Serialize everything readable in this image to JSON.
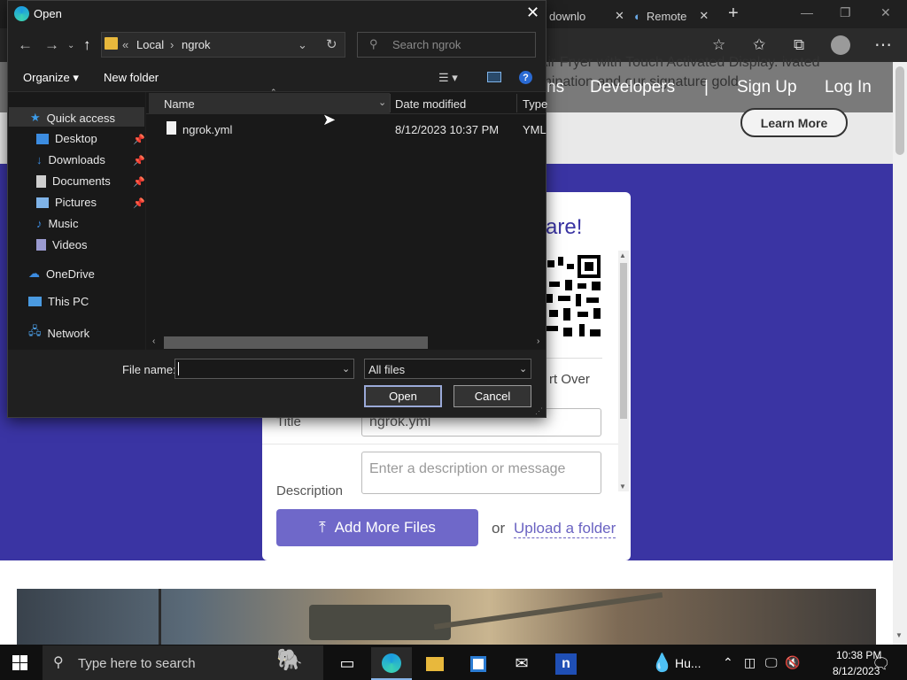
{
  "browser": {
    "tabs": [
      {
        "label": "downlo",
        "close": "✕"
      },
      {
        "label": "Remote",
        "close": "✕"
      }
    ],
    "new_tab": "+",
    "window_controls": {
      "minimize": "—",
      "restore": "❐",
      "close": "✕"
    },
    "toolbar_icons": [
      "add-favorite-icon",
      "favorites-icon",
      "collections-icon",
      "profile-icon",
      "more-icon"
    ],
    "more": "⋯"
  },
  "site": {
    "nav": [
      "ns",
      "Developers",
      "|",
      "Sign Up",
      "Log In"
    ],
    "hero_text": "ur Air Fryer with Touch Activated Display. ivated illumination and our signature gold.",
    "learn_more": "Learn More",
    "card_heading": "are!",
    "start_over": "rt Over",
    "title_label": "Title",
    "title_value": "ngrok.yml",
    "description_label": "Description",
    "description_placeholder": "Enter a description or message",
    "add_files": "Add More Files",
    "or": "or",
    "upload_folder": "Upload a folder"
  },
  "dialog": {
    "title": "Open",
    "close": "✕",
    "address": {
      "overflow": "«",
      "parts": [
        "Local",
        "ngrok"
      ]
    },
    "search_placeholder": "Search ngrok",
    "organize": "Organize ▾",
    "new_folder": "New folder",
    "help": "?",
    "nav": {
      "quick_access": "Quick access",
      "items": [
        {
          "label": "Desktop",
          "icon": "desktop-icon",
          "color": "#3c8ce0"
        },
        {
          "label": "Downloads",
          "icon": "downloads-icon",
          "color": "#3c8ce0"
        },
        {
          "label": "Documents",
          "icon": "documents-icon",
          "color": "#cfcfcf"
        },
        {
          "label": "Pictures",
          "icon": "pictures-icon",
          "color": "#7fb3e8"
        },
        {
          "label": "Music",
          "icon": "music-icon",
          "color": "#3c8ce0"
        },
        {
          "label": "Videos",
          "icon": "videos-icon",
          "color": "#9a9ad0"
        }
      ],
      "onedrive": "OneDrive",
      "this_pc": "This PC",
      "network": "Network"
    },
    "columns": {
      "name": "Name",
      "date": "Date modified",
      "type": "Type"
    },
    "files": [
      {
        "name": "ngrok.yml",
        "date": "8/12/2023 10:37 PM",
        "type": "YML"
      }
    ],
    "file_name_label": "File name:",
    "file_name_value": "",
    "filter": "All files",
    "open": "Open",
    "cancel": "Cancel"
  },
  "taskbar": {
    "search_placeholder": "Type here to search",
    "weather": "Hu...",
    "time": "10:38 PM",
    "date": "8/12/2023",
    "accent": "#87b4e8"
  }
}
